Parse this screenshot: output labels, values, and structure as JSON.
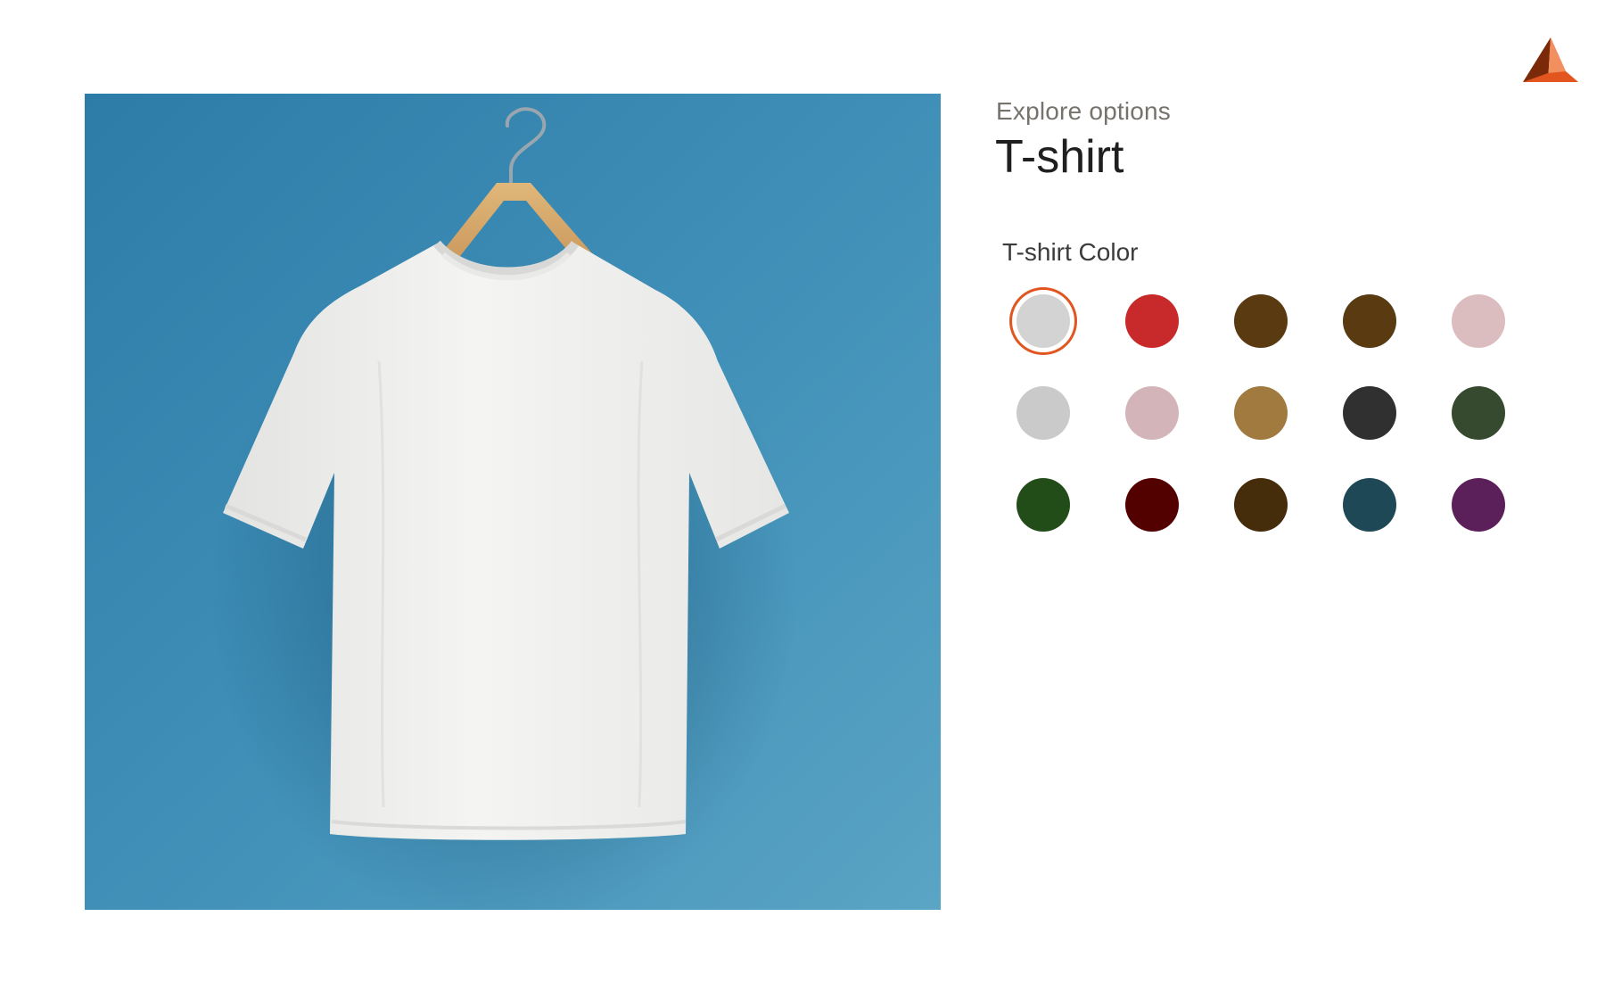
{
  "header": {
    "eyebrow": "Explore options",
    "title": "T-shirt"
  },
  "logo": {
    "icon": "pyramid-logo-icon",
    "colors": [
      "#7a2a08",
      "#e2551f",
      "#f49a6b"
    ]
  },
  "product_image": {
    "icon": "white-tshirt-on-hanger",
    "background_color": "#3f8fb8",
    "shirt_color": "#f2f2f0"
  },
  "color_picker": {
    "label": "T-shirt Color",
    "selected_index": 0,
    "selection_ring_color": "#e2551f",
    "swatches": [
      "#d3d3d3",
      "#c8292b",
      "#5a3a11",
      "#5a3a11",
      "#dbbdbf",
      "#cacaca",
      "#d3b5b9",
      "#a07a3e",
      "#303030",
      "#364a2f",
      "#224d18",
      "#530000",
      "#452c0b",
      "#1e4855",
      "#5b2059"
    ]
  }
}
